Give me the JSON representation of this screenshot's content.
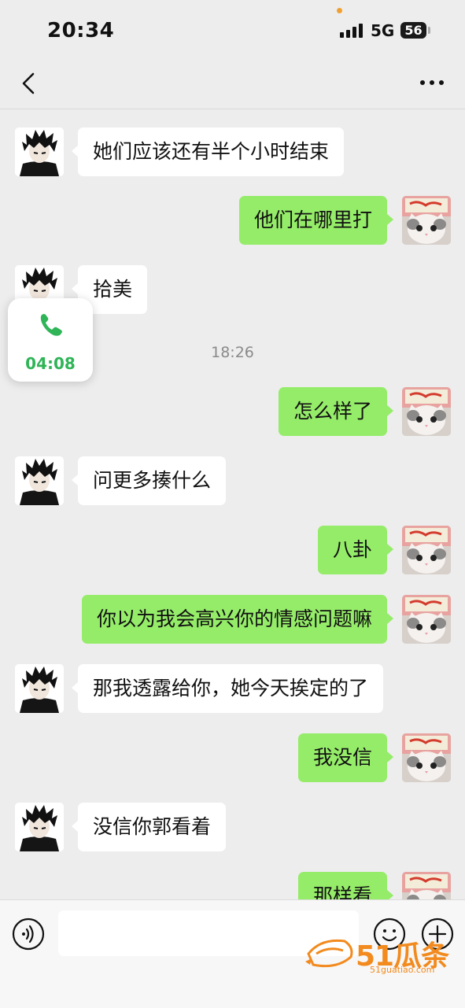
{
  "status_bar": {
    "time": "20:34",
    "network": "5G",
    "battery": "56"
  },
  "nav": {
    "back_icon": "chevron-left-icon",
    "more_icon": "more-dots-icon"
  },
  "call_overlay": {
    "duration": "04:08",
    "icon": "phone-icon",
    "color": "#2fb457"
  },
  "timestamp": "18:26",
  "messages": [
    {
      "side": "in",
      "text": "她们应该还有半个小时结束"
    },
    {
      "side": "out",
      "text": "他们在哪里打"
    },
    {
      "side": "in",
      "text": "拾美"
    },
    {
      "side": "out",
      "text": "怎么样了"
    },
    {
      "side": "in",
      "text": "问更多揍什么"
    },
    {
      "side": "out",
      "text": "八卦"
    },
    {
      "side": "out",
      "text": "你以为我会高兴你的情感问题嘛"
    },
    {
      "side": "in",
      "text": "那我透露给你，她今天挨定的了"
    },
    {
      "side": "out",
      "text": "我没信"
    },
    {
      "side": "in",
      "text": "没信你郭看着"
    },
    {
      "side": "out",
      "text": "那样看"
    }
  ],
  "input_bar": {
    "voice_icon": "voice-icon",
    "emoji_icon": "emoji-icon",
    "plus_icon": "plus-icon"
  },
  "watermark": {
    "text": "51瓜条",
    "url": "51guatiao.com"
  },
  "colors": {
    "outgoing_bubble": "#95ec69",
    "incoming_bubble": "#ffffff",
    "background": "#ededed"
  }
}
